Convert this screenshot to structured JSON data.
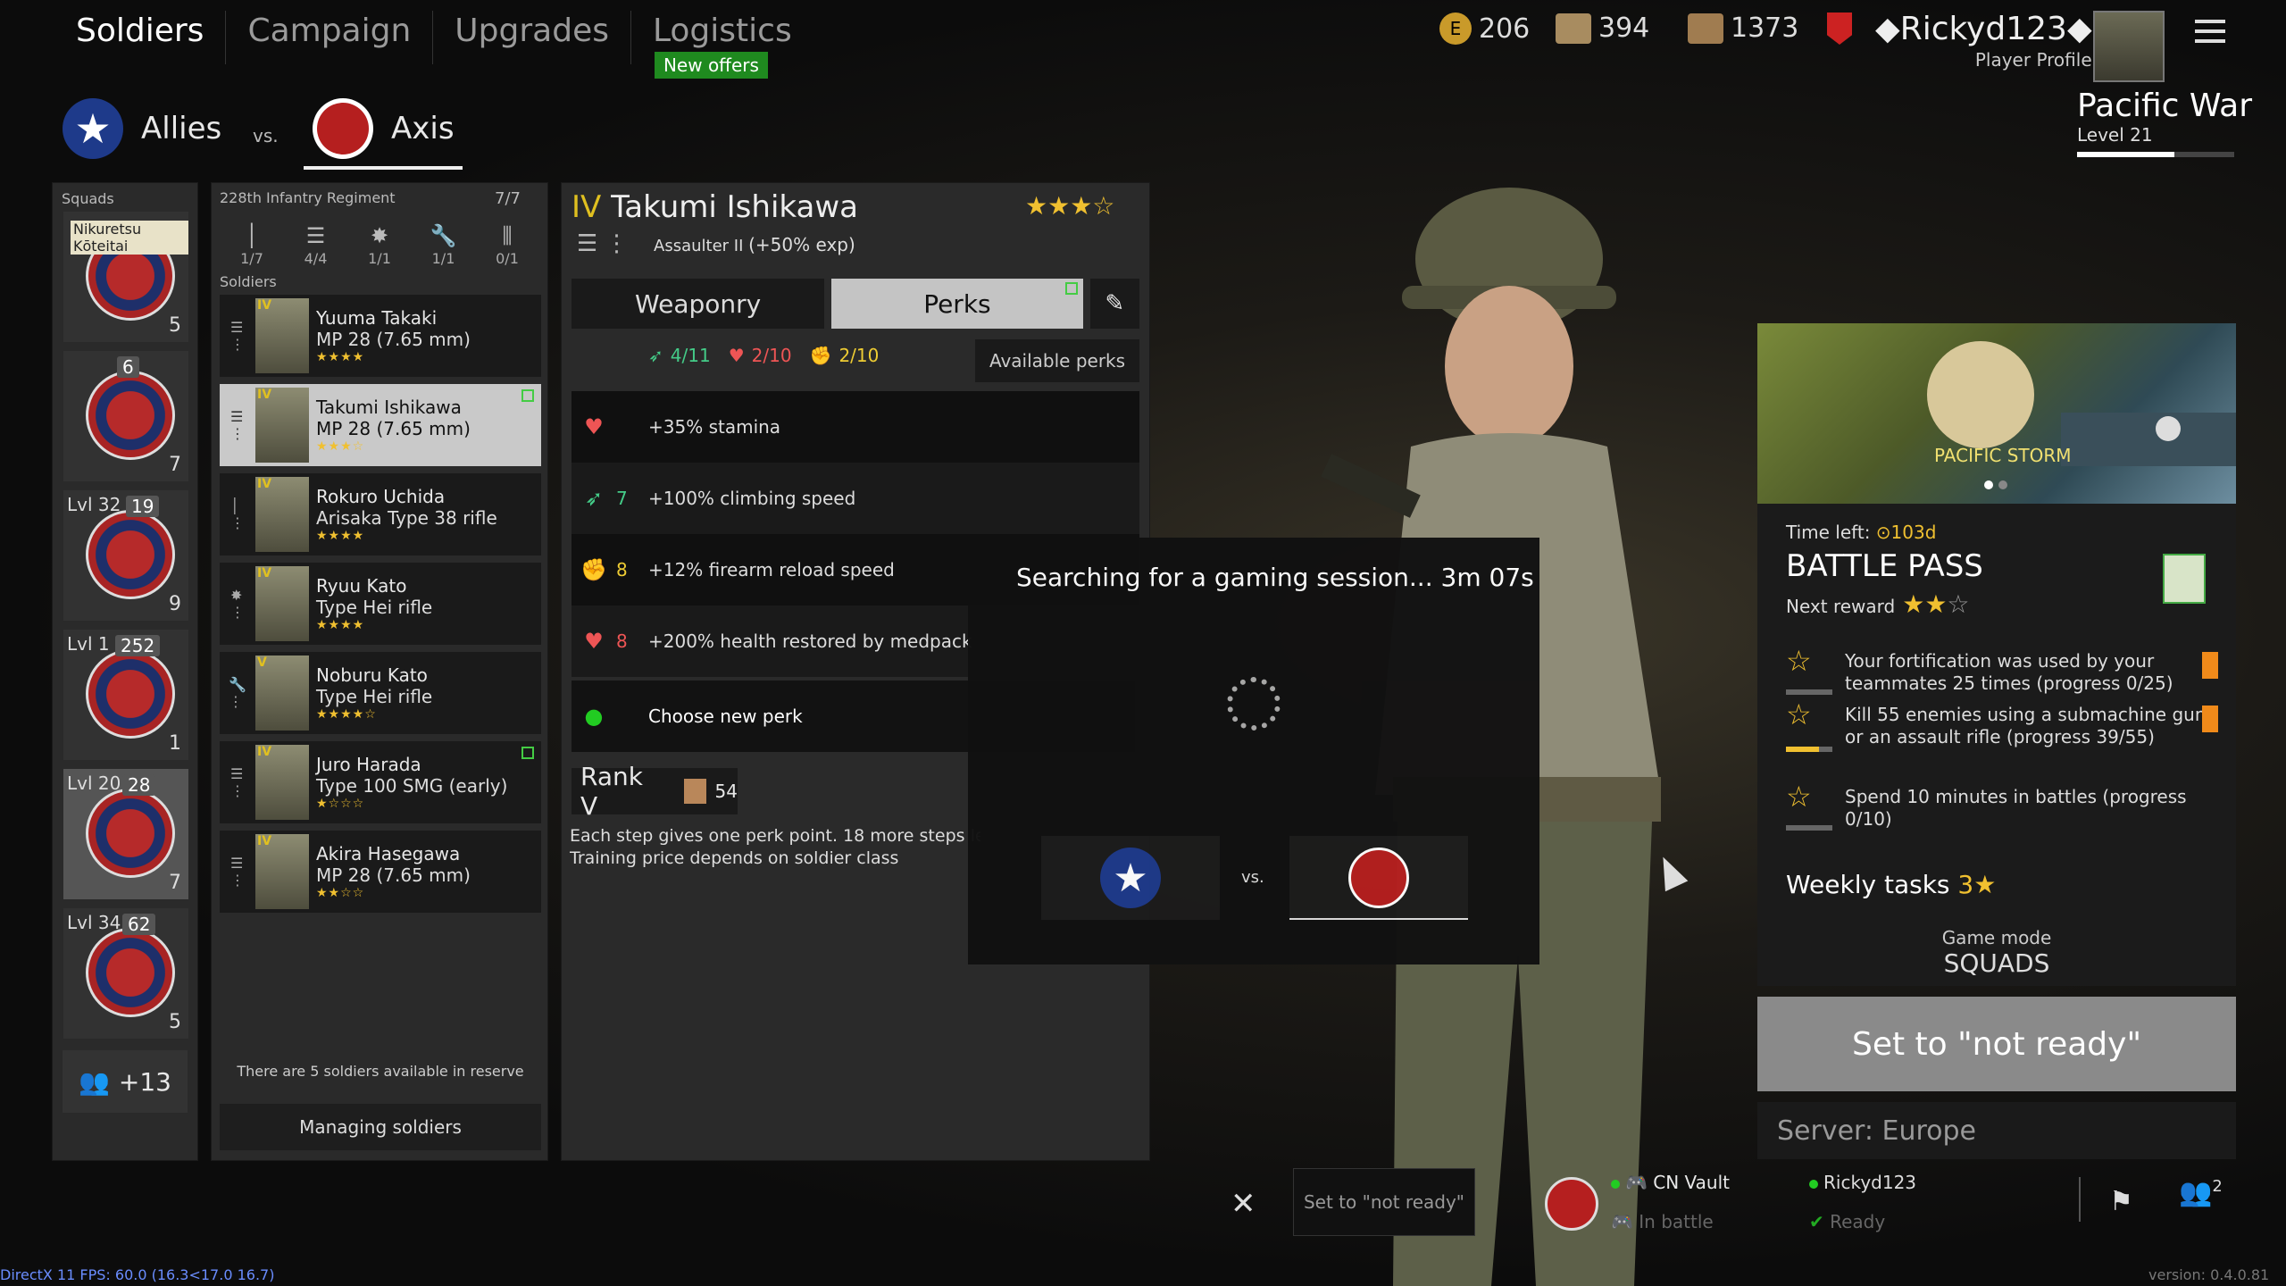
{
  "nav": {
    "tabs": [
      "Soldiers",
      "Campaign",
      "Upgrades",
      "Logistics"
    ],
    "new_offers": "New offers"
  },
  "currency": {
    "gold": "206",
    "silver": "394",
    "tickets": "1373"
  },
  "player": {
    "name": "Rickyd123",
    "profile_label": "Player Profile",
    "campaign": "Pacific War",
    "level": "Level 21",
    "level_progress": 0.62
  },
  "sides": {
    "allies": "Allies",
    "vs": "vs.",
    "axis": "Axis"
  },
  "squads": {
    "header": "Squads",
    "items": [
      {
        "name": "Nikuretsu Kōteitai",
        "count": "5",
        "lvl": "",
        "badge": ""
      },
      {
        "name": "",
        "count": "7",
        "lvl": "",
        "badge": "6"
      },
      {
        "name": "",
        "count": "9",
        "lvl": "Lvl 32",
        "badge": "19"
      },
      {
        "name": "",
        "count": "1",
        "lvl": "Lvl 1",
        "badge": "252"
      },
      {
        "name": "",
        "count": "7",
        "lvl": "Lvl 20",
        "badge": "28"
      },
      {
        "name": "",
        "count": "5",
        "lvl": "Lvl 34",
        "badge": "62"
      }
    ],
    "reserve": "+13"
  },
  "regiment": {
    "name": "228th Infantry Regiment",
    "count": "7/7",
    "stats": [
      "1/7",
      "4/4",
      "1/1",
      "1/1",
      "0/1"
    ],
    "soldiers_label": "Soldiers"
  },
  "soldiers": [
    {
      "rank": "IV",
      "name": "Yuuma Takaki",
      "weapon": "MP 28 (7.65 mm)",
      "stars": "★★★★"
    },
    {
      "rank": "IV",
      "name": "Takumi Ishikawa",
      "weapon": "MP 28 (7.65 mm)",
      "stars": "★★★☆"
    },
    {
      "rank": "IV",
      "name": "Rokuro Uchida",
      "weapon": "Arisaka Type 38 rifle",
      "stars": "★★★★"
    },
    {
      "rank": "IV",
      "name": "Ryuu Kato",
      "weapon": "Type Hei rifle",
      "stars": "★★★★"
    },
    {
      "rank": "V",
      "name": "Noburu Kato",
      "weapon": "Type Hei rifle",
      "stars": "★★★★☆"
    },
    {
      "rank": "IV",
      "name": "Juro Harada",
      "weapon": "Type 100 SMG (early)",
      "stars": "★☆☆☆"
    },
    {
      "rank": "IV",
      "name": "Akira Hasegawa",
      "weapon": "MP 28 (7.65 mm)",
      "stars": "★★☆☆"
    }
  ],
  "reserve_note": "There are 5 soldiers available in reserve",
  "managing": "Managing soldiers",
  "detail": {
    "rank": "IV",
    "name": "Takumi Ishikawa",
    "stars": "★★★☆",
    "class": "Assaulter II",
    "xp": "(+50% exp)",
    "tab_weaponry": "Weaponry",
    "tab_perks": "Perks",
    "pts_agility": "4/11",
    "pts_vitality": "2/10",
    "pts_strength": "2/10",
    "available_perks": "Available perks",
    "perks": [
      {
        "cost": "",
        "text": "+35% stamina"
      },
      {
        "cost": "7",
        "text": "+100% climbing speed"
      },
      {
        "cost": "8",
        "text": "+12% firearm reload speed"
      },
      {
        "cost": "8",
        "text": "+200% health restored by medpack"
      }
    ],
    "choose_perk": "Choose new perk",
    "rank_label": "Rank V",
    "rank_cost": "54",
    "rank_note_1": "Each step gives one perk point. 18 more steps le",
    "rank_note_2": "Training price depends on soldier class"
  },
  "search": {
    "text": "Searching for a gaming session... 3m 07s",
    "vs": "vs."
  },
  "battlepass": {
    "banner": "PACIFIC STORM",
    "time_label": "Time left:",
    "time_value": "⊙103d",
    "title": "BATTLE PASS",
    "next_reward": "Next reward",
    "tasks": [
      {
        "text": "Your fortification was used by your teammates 25 times (progress 0/25)",
        "progress": 0
      },
      {
        "text": "Kill 55 enemies using a submachine gun or an assault rifle (progress 39/55)",
        "progress": 0.71
      },
      {
        "text": "Spend 10 minutes in battles (progress 0/10)",
        "progress": 0
      }
    ],
    "weekly": "Weekly tasks",
    "weekly_stars": "3★",
    "game_mode_label": "Game mode",
    "game_mode": "SQUADS"
  },
  "ready_button": "Set to \"not ready\"",
  "server": "Server: Europe",
  "bottom": {
    "set_not_ready": "Set to \"not ready\"",
    "member1": "CN Vault",
    "member1_status": "In battle",
    "member2": "Rickyd123",
    "member2_status": "Ready",
    "party_count": "2"
  },
  "fps": "DirectX 11 FPS: 60.0 (16.3<17.0 16.7)",
  "version": "version: 0.4.0.81",
  "colors": {
    "accent_gold": "#f0c030",
    "axis_red": "#b51f1f",
    "allies_blue": "#1e2f6a",
    "green": "#1f8a1f"
  }
}
